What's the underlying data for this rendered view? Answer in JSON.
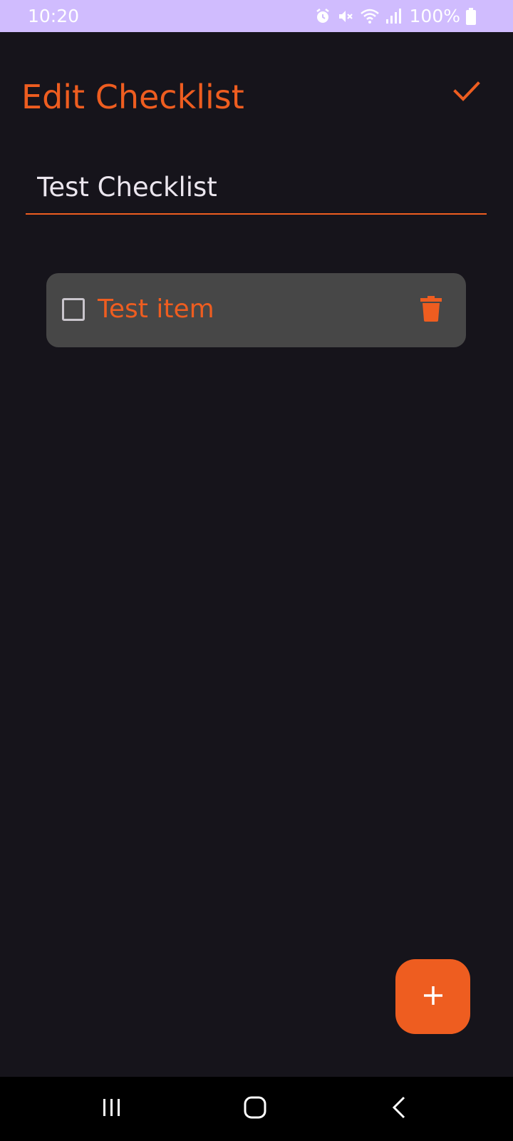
{
  "status_bar": {
    "time": "10:20",
    "battery": "100%",
    "icons": [
      "alarm-icon",
      "mute-icon",
      "wifi-icon",
      "signal-icon",
      "battery-icon"
    ]
  },
  "header": {
    "title": "Edit Checklist",
    "confirm_icon": "check-icon"
  },
  "checklist": {
    "name_value": "Test Checklist",
    "items": [
      {
        "label": "Test item",
        "checked": false
      }
    ]
  },
  "fab": {
    "icon": "plus-icon"
  },
  "nav_bar": {
    "buttons": [
      "recents-icon",
      "home-icon",
      "back-icon"
    ]
  },
  "colors": {
    "accent": "#ee5d20",
    "background": "#16141b",
    "card": "#474747",
    "status_bar": "#d0bcfe",
    "text": "#ebe6ee"
  }
}
